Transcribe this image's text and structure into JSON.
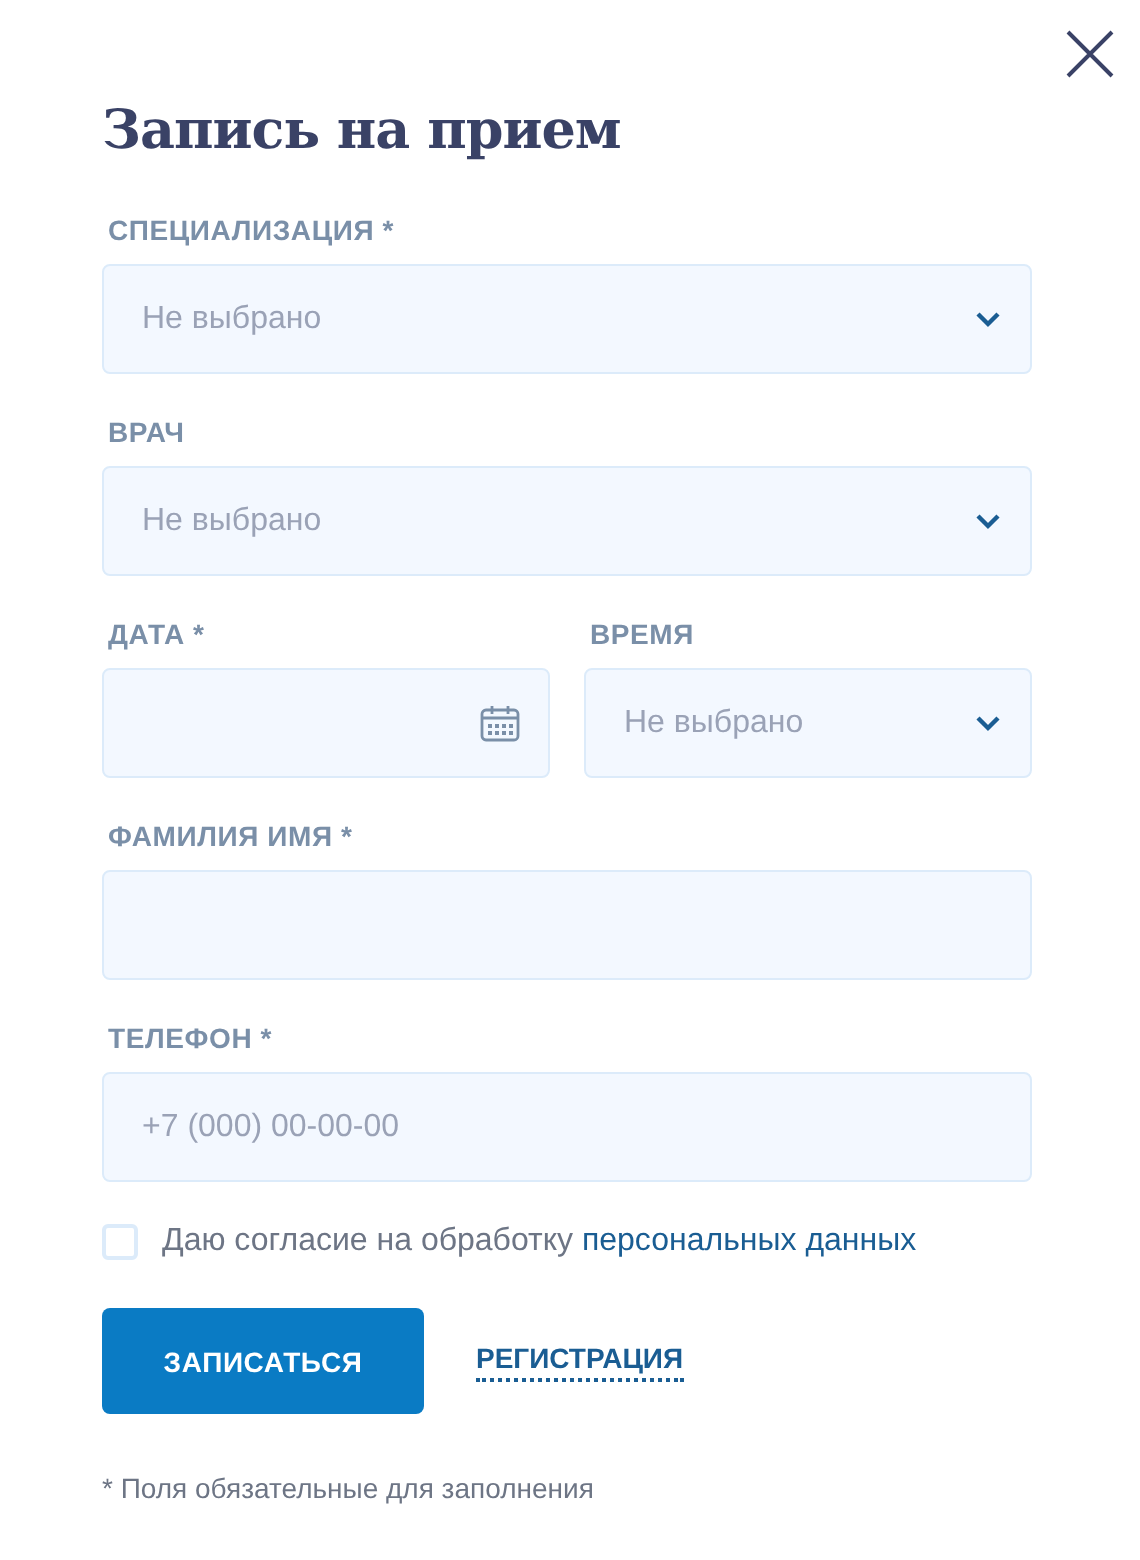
{
  "title": "Запись на прием",
  "rows": [
    {
      "fields": [
        {
          "kind": "select",
          "label": "СПЕЦИАЛИЗАЦИЯ *",
          "placeholder": "Не выбрано"
        }
      ]
    },
    {
      "fields": [
        {
          "kind": "select",
          "label": "ВРАЧ",
          "placeholder": "Не выбрано"
        }
      ]
    },
    {
      "fields": [
        {
          "kind": "date",
          "label": "ДАТА *"
        },
        {
          "kind": "select",
          "label": "ВРЕМЯ",
          "placeholder": "Не выбрано"
        }
      ]
    },
    {
      "fields": [
        {
          "kind": "text",
          "label": "ФАМИЛИЯ ИМЯ *"
        }
      ]
    },
    {
      "fields": [
        {
          "kind": "text",
          "label": "ТЕЛЕФОН *",
          "placeholder": "+7 (000) 00-00-00"
        }
      ]
    }
  ],
  "consent": {
    "checked": false,
    "text": "Даю согласие на обработку ",
    "link": "персональных данных"
  },
  "submit": "ЗАПИСАТЬСЯ",
  "register": "РЕГИСТРАЦИЯ",
  "footnote": "* Поля обязательные для заполнения"
}
